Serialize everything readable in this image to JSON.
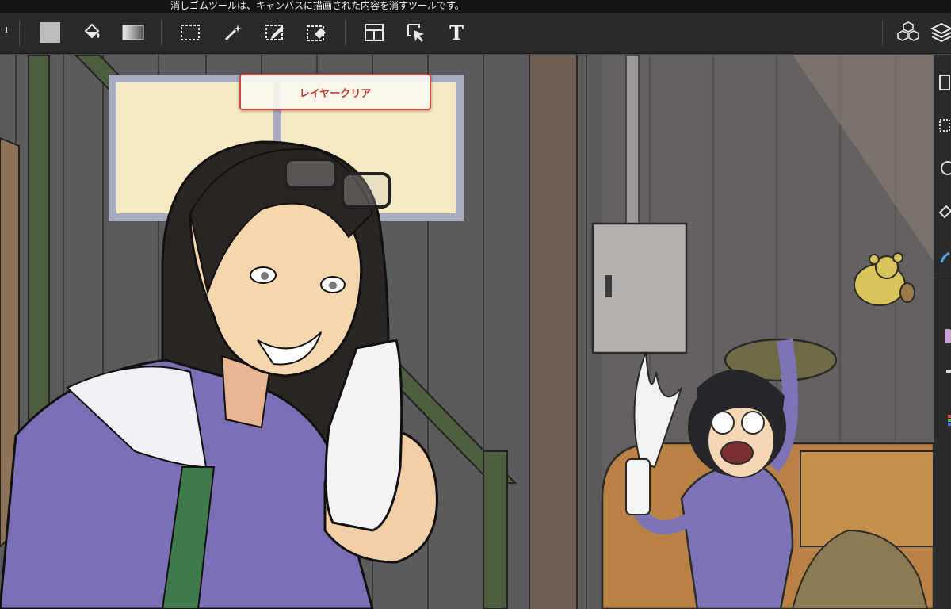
{
  "status_bar": {
    "tooltip": "消しゴムツールは、キャンバスに描画された内容を消すツールです。"
  },
  "toolbar": {
    "tools": [
      {
        "name": "fill-color-swatch",
        "icon": "gray-square-icon"
      },
      {
        "name": "bucket-fill",
        "icon": "paint-bucket-icon"
      },
      {
        "name": "gradient",
        "icon": "gradient-rect-icon"
      },
      {
        "name": "rect-select",
        "icon": "dashed-rect-icon"
      },
      {
        "name": "magic-wand",
        "icon": "magic-wand-icon"
      },
      {
        "name": "select-pen",
        "icon": "selection-pen-icon"
      },
      {
        "name": "select-eraser",
        "icon": "selection-eraser-icon"
      },
      {
        "name": "frame-divide",
        "icon": "frame-layout-icon"
      },
      {
        "name": "operation",
        "icon": "arrow-select-icon"
      },
      {
        "name": "text",
        "icon": "text-icon",
        "label": "T"
      },
      {
        "name": "materials",
        "icon": "cubes-icon"
      },
      {
        "name": "layers",
        "icon": "layers-icon"
      }
    ]
  },
  "canvas_action": {
    "layer_clear_label": "レイヤークリア"
  },
  "colors": {
    "toolbar_bg": "#2a2a2a",
    "accent_red": "#d9443a",
    "right_panel_color_chip": "#c9a2d6"
  }
}
